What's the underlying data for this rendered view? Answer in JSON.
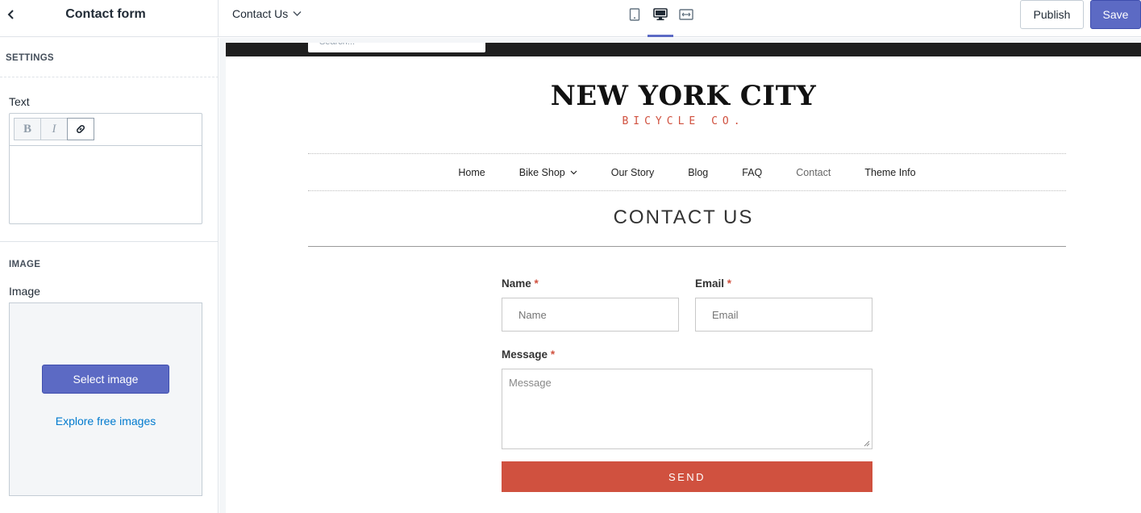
{
  "topbar": {
    "panel_title": "Contact form",
    "page_selector": "Contact Us",
    "devices": [
      "mobile-icon",
      "desktop-icon",
      "fullscreen-icon"
    ],
    "active_device": "desktop",
    "publish_label": "Publish",
    "save_label": "Save"
  },
  "sidebar": {
    "settings_heading": "SETTINGS",
    "text_label": "Text",
    "editor_buttons": [
      "B",
      "I"
    ],
    "image_heading": "IMAGE",
    "image_label": "Image",
    "select_image_label": "Select image",
    "explore_link": "Explore free images"
  },
  "preview": {
    "search_placeholder": "Search...",
    "logo_title": "NEW YORK CITY",
    "logo_subtitle": "BICYCLE CO.",
    "nav": [
      "Home",
      "Bike Shop",
      "Our Story",
      "Blog",
      "FAQ",
      "Contact",
      "Theme Info"
    ],
    "active_nav": "Contact",
    "page_heading": "CONTACT US",
    "form": {
      "name_label": "Name",
      "name_placeholder": "Name",
      "email_label": "Email",
      "email_placeholder": "Email",
      "message_label": "Message",
      "message_placeholder": "Message",
      "required_marker": "*",
      "send_label": "SEND"
    }
  },
  "colors": {
    "accent": "#5c6ac4",
    "brand_red": "#d0513f",
    "link": "#007ace"
  }
}
